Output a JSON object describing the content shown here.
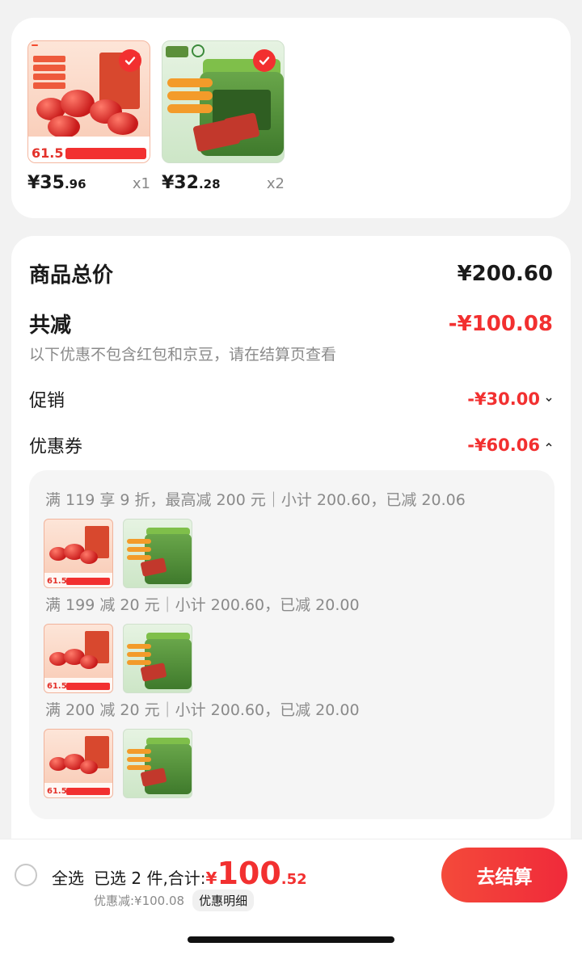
{
  "products": [
    {
      "name": "dates",
      "price_main": "¥35",
      "price_decimal": ".96",
      "qty": "x1",
      "badge_price": "61.5"
    },
    {
      "name": "jar",
      "price_main": "¥32",
      "price_decimal": ".28",
      "qty": "x2"
    }
  ],
  "summary": {
    "total_label": "商品总价",
    "total_value": "¥200.60",
    "reduce_label": "共减",
    "reduce_value": "-¥100.08",
    "reduce_note": "以下优惠不包含红包和京豆，请在结算页查看",
    "promo_label": "促销",
    "promo_value": "-¥30.00",
    "coupon_label": "优惠券",
    "coupon_value": "-¥60.06"
  },
  "coupons": [
    {
      "text": "满 119 享 9 折，最高减 200 元｜小计 200.60，已减 20.06"
    },
    {
      "text": "满 199 减 20 元｜小计 200.60，已减 20.00"
    },
    {
      "text": "满 200 减 20 元｜小计 200.60，已减 20.00"
    }
  ],
  "footer": {
    "select_all": "全选",
    "selected_text": "已选 2 件,合计:",
    "yen": "¥",
    "amount_int": "100",
    "amount_dec": ".52",
    "discount_text": "优惠减:¥100.08",
    "discount_detail": "优惠明细",
    "checkout": "去结算"
  },
  "colors": {
    "accent": "#f23030"
  }
}
